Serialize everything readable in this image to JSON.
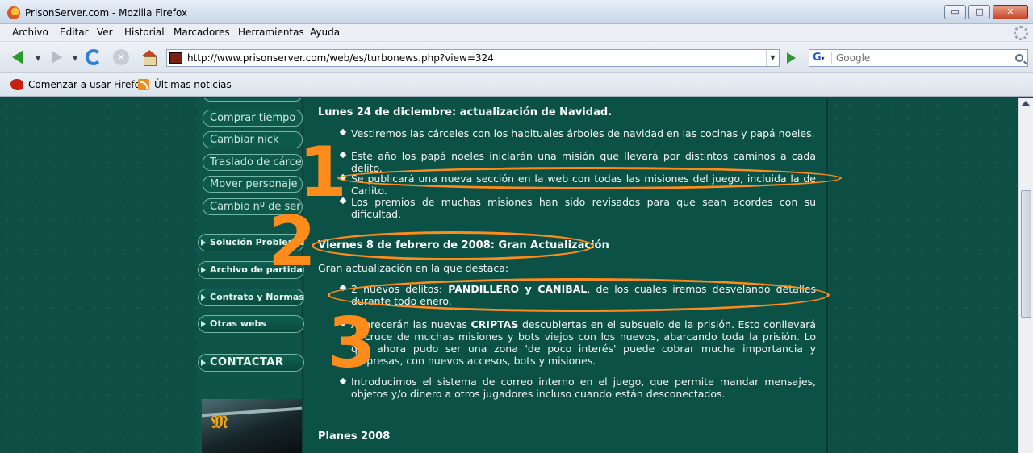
{
  "window": {
    "title": "PrisonServer.com - Mozilla Firefox",
    "buttons": {
      "minimize": "▭",
      "maximize": "□",
      "close": "✕"
    }
  },
  "menu": [
    "Archivo",
    "Editar",
    "Ver",
    "Historial",
    "Marcadores",
    "Herramientas",
    "Ayuda"
  ],
  "nav": {
    "url": "http://www.prisonserver.com/web/es/turbonews.php?view=324",
    "search_engine": "G",
    "search_placeholder": "Google"
  },
  "bookmarks": [
    "Comenzar a usar Firefox",
    "Últimas noticias"
  ],
  "sidebar": {
    "pills": [
      "Comprar tiempo",
      "Cambiar nick",
      "Traslado de cárcel",
      "Mover personaje",
      "Cambio nº de serie"
    ],
    "sections": [
      "Solución Problemas",
      "Archivo de partidas",
      "Contrato y Normas",
      "Otras webs"
    ],
    "contact": "CONTACTAR"
  },
  "news": {
    "post1": {
      "title": "Lunes 24 de diciembre: actualización de Navidad.",
      "items": [
        "Vestiremos las cárceles con los habituales árboles de navidad en las cocinas y papá noeles.",
        "Este año los papá noeles iniciarán una misión que llevará por distintos caminos a cada delito.",
        "Se publicará una nueva sección en la web con todas las misiones del juego, incluida la de Carlito.",
        "Los premios de muchas misiones han sido revisados para que sean acordes con su dificultad."
      ]
    },
    "post2": {
      "title": "Viernes 8 de febrero de 2008: Gran Actualización",
      "intro": "Gran actualización en la que destaca:",
      "item1_prefix": "2 nuevos delitos: ",
      "item1_bold": "PANDILLERO y CANIBAL",
      "item1_suffix": ", de los cuales iremos desvelando detalles durante todo enero.",
      "item2_prefix": "Aparecerán las nuevas ",
      "item2_bold": "CRIPTAS",
      "item2_suffix": " descubiertas en el subsuelo de la prisión. Esto conllevará el cruce de muchas misiones y bots viejos con los nuevos, abarcando toda la prisión. Lo que ahora pudo ser una zona 'de poco interés' puede cobrar mucha importancia y sorpresas, con nuevos accesos, bots y misiones.",
      "item3": "Introducimos el sistema de correo interno en el juego, que permite mandar mensajes, objetos y/o dinero a otros jugadores incluso cuando están desconectados."
    },
    "post3": {
      "title": "Planes 2008"
    }
  },
  "annotations": {
    "marks": [
      "1",
      "2",
      "3"
    ],
    "color": "#ff8c1a"
  }
}
